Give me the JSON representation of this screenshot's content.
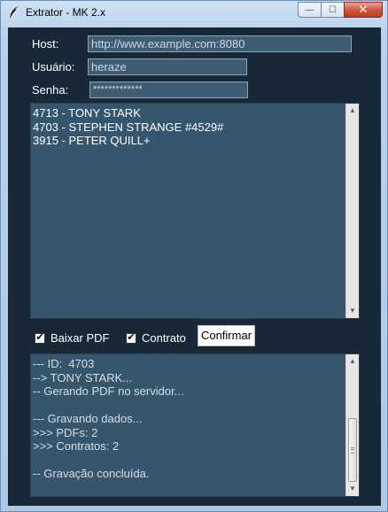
{
  "window": {
    "title": "Extrator - MK 2.x",
    "minimize_glyph": "—",
    "maximize_glyph": "☐",
    "close_glyph": "✕"
  },
  "form": {
    "host_label": "Host:",
    "host_value": "http://www.example.com:8080",
    "user_label": "Usuário:",
    "user_value": "heraze",
    "password_label": "Senha:",
    "password_value": "*************"
  },
  "input_list": {
    "lines": [
      "4713 - TONY STARK",
      "4703 - STEPHEN STRANGE #4529#",
      "3915 - PETER QUILL+"
    ]
  },
  "options": {
    "pdf_label": "Baixar PDF",
    "pdf_checked": true,
    "contract_label": "Contrato",
    "contract_checked": true,
    "confirm_label": "Confirmar",
    "check_glyph": "✔"
  },
  "log": {
    "lines": [
      "--- ID:  4703",
      "--> TONY STARK...",
      "-- Gerando PDF no servidor...",
      "",
      "--- Gravando dados...",
      ">>> PDFs: 2",
      ">>> Contratos: 2",
      "",
      "-- Gravação concluída."
    ],
    "scroll_position": "bottom"
  },
  "icons": {
    "app": "feather-icon",
    "scroll_up": "arrow-up-icon",
    "scroll_down": "arrow-down-icon"
  },
  "colors": {
    "background": "#182836",
    "field": "#3f5c75",
    "textarea": "#36566e"
  }
}
